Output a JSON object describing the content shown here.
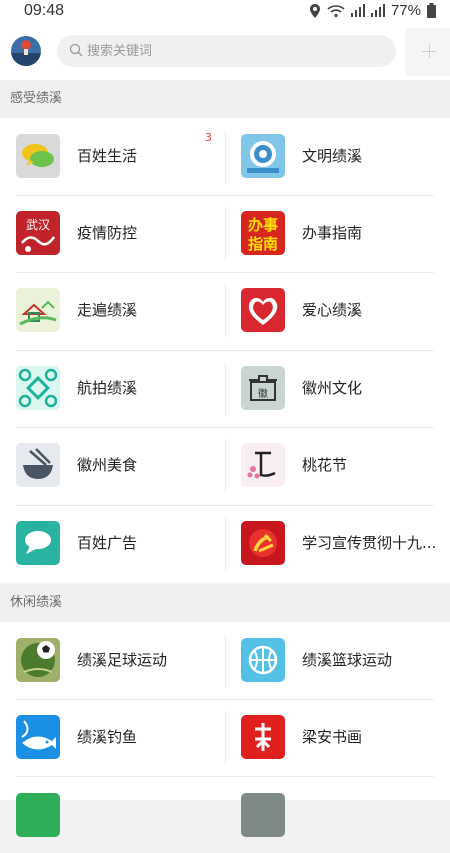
{
  "status": {
    "time": "09:48",
    "battery": "77%"
  },
  "search": {
    "placeholder": "搜索关键词"
  },
  "sections": [
    {
      "title": "感受绩溪",
      "items": [
        {
          "label": "百姓生活",
          "badge": "3",
          "icon": "chat-bubbles-icon"
        },
        {
          "label": "文明绩溪",
          "icon": "civilization-emblem-icon"
        },
        {
          "label": "疫情防控",
          "icon": "wuhan-fight-icon"
        },
        {
          "label": "办事指南",
          "icon": "service-guide-icon"
        },
        {
          "label": "走遍绩溪",
          "icon": "landscape-house-icon"
        },
        {
          "label": "爱心绩溪",
          "icon": "heart-icon"
        },
        {
          "label": "航拍绩溪",
          "icon": "drone-icon"
        },
        {
          "label": "徽州文化",
          "icon": "huizhou-architecture-icon"
        },
        {
          "label": "徽州美食",
          "icon": "noodle-bowl-icon"
        },
        {
          "label": "桃花节",
          "icon": "peach-blossom-icon"
        },
        {
          "label": "百姓广告",
          "icon": "speech-bubble-icon"
        },
        {
          "label": "学习宣传贯彻十九...",
          "icon": "party-emblem-icon"
        }
      ]
    },
    {
      "title": "休闲绩溪",
      "items": [
        {
          "label": "绩溪足球运动",
          "icon": "football-icon"
        },
        {
          "label": "绩溪篮球运动",
          "icon": "basketball-icon"
        },
        {
          "label": "绩溪钓鱼",
          "icon": "fishing-icon"
        },
        {
          "label": "梁安书画",
          "icon": "calligraphy-icon"
        }
      ]
    }
  ]
}
